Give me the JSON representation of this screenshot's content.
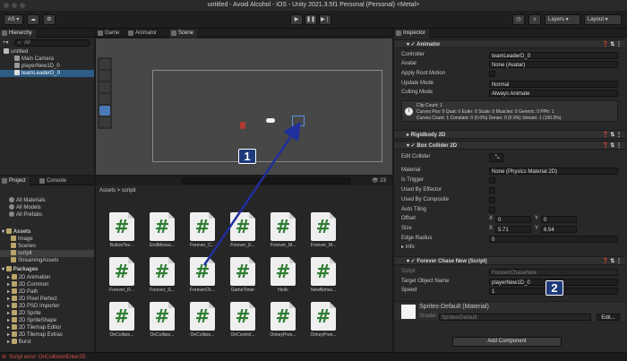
{
  "window": {
    "title": "untitled - Avoid Alcohol - iOS - Unity 2021.3.5f1 Personal (Personal) <Metal>"
  },
  "toolbar": {
    "account": "AS",
    "layers": "Layers",
    "layout": "Layout"
  },
  "hierarchy": {
    "tab": "Hierarchy",
    "search_placeholder": "All",
    "items": [
      "untitled",
      "Main Camera",
      "playerNew1D_0",
      "teamLeaderD_0"
    ]
  },
  "center_tabs": [
    "Game",
    "Animator",
    "Scene"
  ],
  "project": {
    "tabs": [
      "Project",
      "Console"
    ],
    "favorites": [
      "All Materials",
      "All Models",
      "All Prefabs"
    ],
    "assets_label": "Assets",
    "asset_folders": [
      "Image",
      "Scenes",
      "scripit",
      "StreamingAssets"
    ],
    "packages_label": "Packages",
    "packages": [
      "2D Animation",
      "2D Common",
      "2D Path",
      "2D Pixel Perfect",
      "2D PSD Importer",
      "2D Sprite",
      "2D SpriteShape",
      "2D Tilemap Editor",
      "2D Tilemap Extras",
      "Burst"
    ],
    "breadcrumb": [
      "Assets",
      "scripit"
    ],
    "item_count": "23",
    "files": [
      "ButtonTes...",
      "EndMessa...",
      "Forever_C...",
      "Forever_E...",
      "Forever_M...",
      "Forever_M...",
      "Forever_R...",
      "Forever_S...",
      "ForeverCh...",
      "GameTimer",
      "Hello",
      "NewBehav...",
      "OnCollisio...",
      "OnCollisio...",
      "OnCollisio...",
      "OnControl...",
      "OnkeyPres...",
      "OnkeyPres..."
    ]
  },
  "inspector": {
    "tab": "Inspector",
    "animator": {
      "title": "Animator",
      "controller_label": "Controller",
      "controller_value": "teamLeaderD_0",
      "avatar_label": "Avatar",
      "avatar_value": "None (Avatar)",
      "root_motion_label": "Apply Root Motion",
      "update_mode_label": "Update Mode",
      "update_mode_value": "Normal",
      "culling_mode_label": "Culling Mode",
      "culling_mode_value": "Always Animate",
      "info_line1": "Clip Count: 1",
      "info_line2": "Curves Pos: 0 Quat: 0 Euler: 0 Scale: 0 Muscles: 0 Generic: 0 PPtr: 1",
      "info_line3": "Curves Count: 1 Constant: 0 (0.0%) Dense: 0 (0.0%) Stream: 1 (100.0%)"
    },
    "rigidbody": {
      "title": "Rigidbody 2D"
    },
    "box_collider": {
      "title": "Box Collider 2D",
      "edit_collider_label": "Edit Collider",
      "material_label": "Material",
      "material_value": "None (Physics Material 2D)",
      "is_trigger_label": "Is Trigger",
      "used_by_effector_label": "Used By Effector",
      "used_by_composite_label": "Used By Composite",
      "auto_tiling_label": "Auto Tiling",
      "offset_label": "Offset",
      "offset_x": "0",
      "offset_y": "0",
      "size_label": "Size",
      "size_x": "5.71",
      "size_y": "6.54",
      "edge_radius_label": "Edge Radius",
      "edge_radius_value": "0",
      "info_label": "Info"
    },
    "forever_chase": {
      "title": "Forever Chase New (Script)",
      "script_label": "Script",
      "script_value": "ForeverChaseNew",
      "target_label": "Target Object Name",
      "target_value": "playerNew1D_0",
      "speed_label": "Speed",
      "speed_value": "1"
    },
    "material": {
      "title": "Sprites-Default (Material)",
      "shader_label": "Shader",
      "shader_value": "Sprites/Default",
      "edit_label": "Edit..."
    },
    "add_component": "Add Component"
  },
  "annotations": {
    "badge1": "1",
    "badge2": "2"
  },
  "status": {
    "error": "Script error: OnCollisionEnter2D"
  },
  "colors": {
    "accent": "#2c5d87",
    "badge": "#1d3a7a",
    "arrow": "#1f2f9c",
    "script_green": "#2e7d32",
    "error": "#d9534f"
  }
}
